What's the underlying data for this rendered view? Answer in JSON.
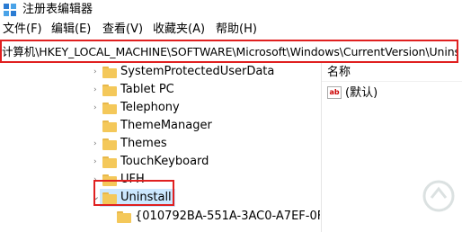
{
  "window": {
    "title": "注册表编辑器"
  },
  "menu": {
    "items": [
      {
        "label": "文件(F)"
      },
      {
        "label": "编辑(E)"
      },
      {
        "label": "查看(V)"
      },
      {
        "label": "收藏夹(A)"
      },
      {
        "label": "帮助(H)"
      }
    ]
  },
  "address": {
    "path": "计算机\\HKEY_LOCAL_MACHINE\\SOFTWARE\\Microsoft\\Windows\\CurrentVersion\\Uninstall"
  },
  "tree": {
    "items": [
      {
        "label": "SystemProtectedUserData",
        "expander": "›"
      },
      {
        "label": "Tablet PC",
        "expander": "›"
      },
      {
        "label": "Telephony",
        "expander": "›"
      },
      {
        "label": "ThemeManager",
        "expander": ""
      },
      {
        "label": "Themes",
        "expander": "›"
      },
      {
        "label": "TouchKeyboard",
        "expander": "›"
      },
      {
        "label": "UFH",
        "expander": "›"
      },
      {
        "label": "Uninstall",
        "expander": "⌄",
        "selected": true
      },
      {
        "label": "{010792BA-551A-3AC0-A7EF-0F",
        "expander": ""
      }
    ]
  },
  "values_pane": {
    "column_name": "名称",
    "rows": [
      {
        "name": "(默认)",
        "icon": "ab-string-icon"
      }
    ]
  },
  "colors": {
    "highlight": "#e02020",
    "selection": "#cce8ff",
    "folder": "#f4c85a"
  }
}
